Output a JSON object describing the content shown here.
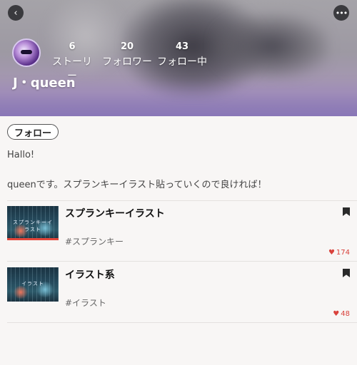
{
  "header": {
    "back_icon": "chevron-left-icon",
    "more_icon": "more-horizontal-icon",
    "back_glyph": "‹",
    "more_glyph": "•••"
  },
  "profile": {
    "name": "J・queen",
    "stats": {
      "stories": {
        "count": "6",
        "label": "ストーリー"
      },
      "followers": {
        "count": "20",
        "label": "フォロワー"
      },
      "following": {
        "count": "43",
        "label": "フォロー中"
      }
    },
    "follow_label": "フォロー",
    "bio": "Hallo!\n\nqueenです。スプランキーイラスト貼っていくので良ければ！"
  },
  "stories": [
    {
      "title": "スプランキーイラスト",
      "tag": "#スプランキー",
      "likes": "174",
      "thumb_text": "スプランキーイラスト",
      "progress": 1.0
    },
    {
      "title": "イラスト系",
      "tag": "#イラスト",
      "likes": "48",
      "thumb_text": "イラスト",
      "progress": 0
    }
  ],
  "colors": {
    "accent_red": "#d9423c",
    "progress_red": "#e2463a"
  }
}
